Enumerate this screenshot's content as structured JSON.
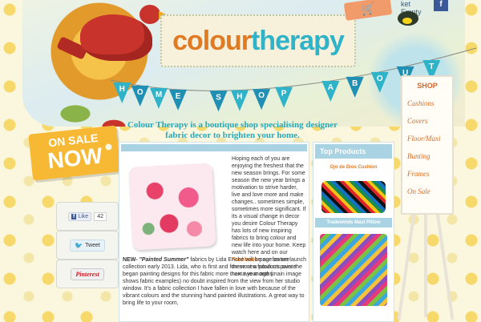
{
  "header": {
    "logo_part1": "colour",
    "logo_part2": "therapy",
    "cart_status_line1": "ket",
    "cart_status_line2": "Empty",
    "facebook_label": "f"
  },
  "nav": {
    "items": [
      {
        "label": "HOME",
        "letters": [
          "H",
          "O",
          "M",
          "E"
        ]
      },
      {
        "label": "SHOP",
        "letters": [
          "S",
          "H",
          "O",
          "P"
        ]
      },
      {
        "label": "ABOUT",
        "letters": [
          "A",
          "B",
          "O",
          "U",
          "T"
        ]
      }
    ],
    "flag_colors": [
      "#2eb3c8",
      "#1f8fb4",
      "#2eb3c8",
      "#1f8fb4"
    ]
  },
  "sale": {
    "line1": "ON SALE",
    "line2": "NOW"
  },
  "tagline": "Colour Therapy is a boutique shop specialising designer fabric decor to brighten your home.",
  "main": {
    "intro_before_link": "Hoping each of you are enjoying the freshest that the new season brings. For some season the new year brings a motivation to strive harder, live and love more and make changes.. sometimes simple, sometimes more significant. If its a visual change in decor you desire Colour Therapy has lots of new inspiring fabrics to bring colour and new life into your home. Keep watch here and on our",
    "facebook_link": "Facebook",
    "intro_after_link": "page as we launch these new products over the next two months.",
    "para2_new": "NEW-",
    "para2_title": "\"Painted Summer\"",
    "para2_text": "fabrics by Lida Enché will be our feature collection early 2013. Lida, who is first and foremost a fabulous painter began painting designs for this fabric more than a year ago (main image shows fabric examples) no doubt inspired from the view from her studio window. It's a fabric collection I have fallen in love with because of the vibrant colours and the stunning hand painted illustrations. A great way to bring life to your room,"
  },
  "sidebar": {
    "title": "Top Products",
    "product1": "Ojo de Dios Cushion",
    "product2": "Tradewinds Maxi Pillow"
  },
  "social": {
    "like_label": "Like",
    "like_count": "42",
    "tweet_label": "Tweet",
    "pin_label": "Pinterest"
  },
  "shop_menu": {
    "title": "SHOP",
    "items": [
      "Cushions",
      "Covers",
      "Floor/Maxi",
      "Bunting",
      "Frames",
      "On Sale"
    ]
  },
  "colors": {
    "accent_orange": "#e07a23",
    "accent_teal": "#2eb3c8",
    "panel_blue": "#a9d3e3"
  }
}
